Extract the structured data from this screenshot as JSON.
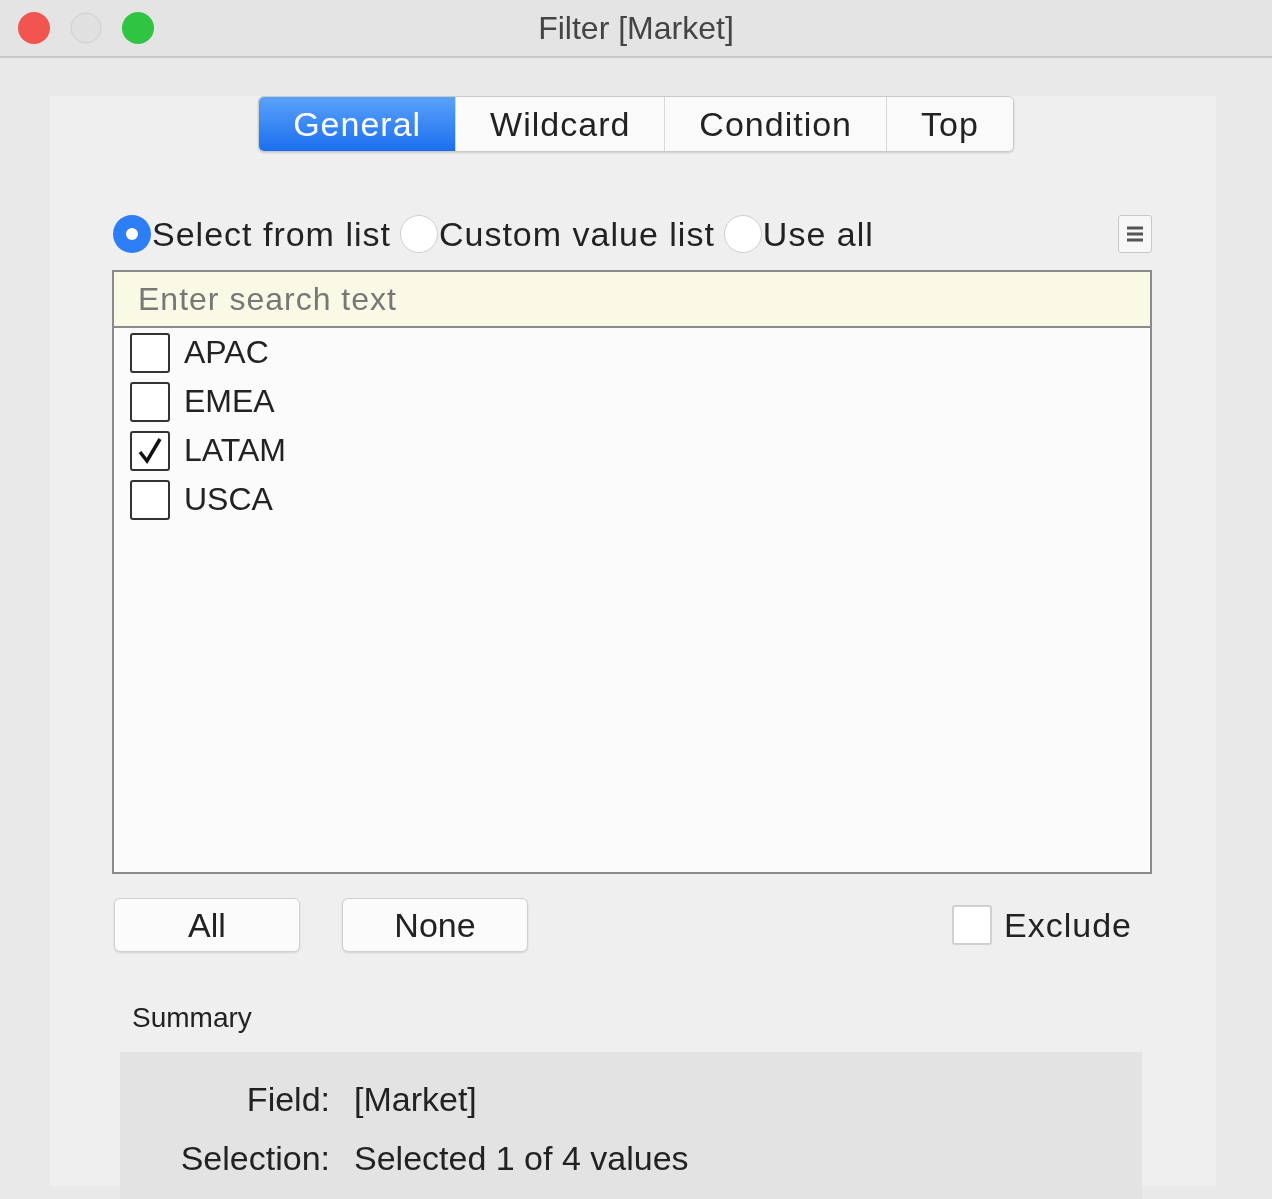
{
  "window": {
    "title": "Filter [Market]"
  },
  "tabs": [
    {
      "label": "General",
      "selected": true
    },
    {
      "label": "Wildcard",
      "selected": false
    },
    {
      "label": "Condition",
      "selected": false
    },
    {
      "label": "Top",
      "selected": false
    }
  ],
  "modes": [
    {
      "label": "Select from list",
      "selected": true
    },
    {
      "label": "Custom value list",
      "selected": false
    },
    {
      "label": "Use all",
      "selected": false
    }
  ],
  "search": {
    "placeholder": "Enter search text"
  },
  "values": [
    {
      "label": "APAC",
      "checked": false
    },
    {
      "label": "EMEA",
      "checked": false
    },
    {
      "label": "LATAM",
      "checked": true
    },
    {
      "label": "USCA",
      "checked": false
    }
  ],
  "buttons": [
    "All",
    "None"
  ],
  "exclude": {
    "label": "Exclude",
    "checked": false
  },
  "summary": {
    "title": "Summary",
    "rows": [
      {
        "label": "Field:",
        "value": "[Market]"
      },
      {
        "label": "Selection:",
        "value": "Selected 1 of 4 values"
      }
    ]
  }
}
